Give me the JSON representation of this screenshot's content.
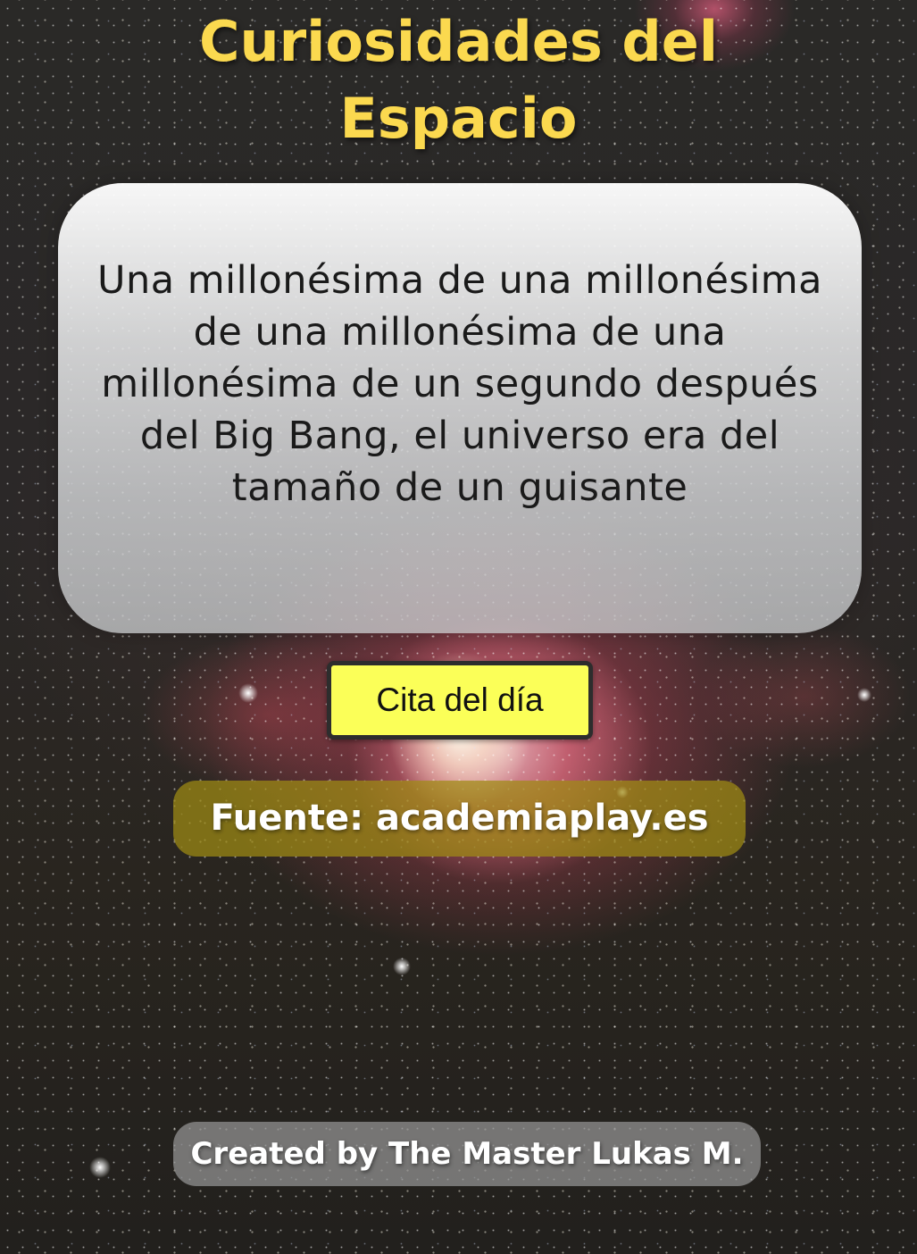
{
  "page": {
    "title_line1": "Curiosidades del",
    "title_line2": "Espacio"
  },
  "quote": {
    "text": "Una millonésima de una millonésima de una millonésima de una millonésima de un segundo después del Big Bang, el universo era del tamaño de un guisante"
  },
  "actions": {
    "cite_button_label": "Cita del día"
  },
  "source": {
    "label": "Fuente: academiaplay.es"
  },
  "footer": {
    "credits": "Created by The Master Lukas M."
  },
  "colors": {
    "title": "#fbd94f",
    "button_bg": "#fbff58",
    "source_bg": "#a08c14",
    "credits_bg": "#969696"
  }
}
